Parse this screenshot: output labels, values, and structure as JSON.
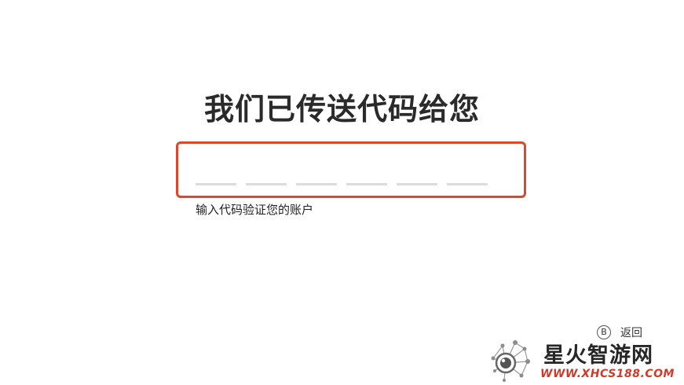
{
  "title": "我们已传送代码给您",
  "code_input": {
    "slots": [
      "",
      "",
      "",
      "",
      "",
      ""
    ],
    "focus_color": "#e0452d"
  },
  "hint": "输入代码验证您的账户",
  "footer": {
    "back_key": "B",
    "back_label": "返回"
  },
  "watermark": {
    "name": "星火智游网",
    "url": "WWW.XHCS188.COM",
    "url_color": "#d03a2a"
  }
}
